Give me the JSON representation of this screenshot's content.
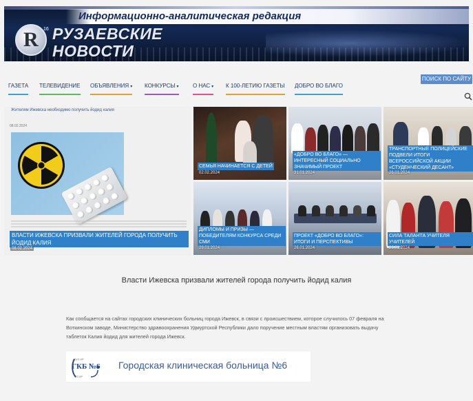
{
  "header": {
    "tagline": "Информационно-аналитическая редакция",
    "logo_letter": "R",
    "logo_age": "16",
    "logo_line1": "РУЗАЕВСКИЕ",
    "logo_line2": "НОВОСТИ",
    "search_button": "ПОИСК ПО САЙТУ"
  },
  "nav": {
    "items": [
      {
        "label": "ГАЗЕТА",
        "underline": "#3aa0d8"
      },
      {
        "label": "ТЕЛЕВИДЕНИЕ",
        "underline": "#5cb85c"
      },
      {
        "label": "ОБЪЯВЛЕНИЯ",
        "underline": "#e0a030",
        "caret": "▾"
      },
      {
        "label": "КОНКУРСЫ",
        "underline": "#9b59b6",
        "caret": "▾"
      },
      {
        "label": "О НАС",
        "underline": "#e74c8c",
        "caret": "▾"
      },
      {
        "label": "К 100-ЛЕТИЮ ГАЗЕТЫ",
        "underline": "#e0a030"
      },
      {
        "label": "ДОБРО ВО БЛАГО",
        "underline": "#3aa0d8"
      }
    ]
  },
  "featured": {
    "top_caption": "Жителям Ижевска необходимо получить йодид калия",
    "top_date": "08.02.2024",
    "title": "ВЛАСТИ ИЖЕВСКА ПРИЗВАЛИ ЖИТЕЛЕЙ ГОРОДА ПОЛУЧИТЬ ЙОДИД КАЛИЯ",
    "date": "08.02.2024"
  },
  "tiles": [
    {
      "title": "СЕМЬЯ НАЧИНАЕТСЯ С ДЕТЕЙ",
      "date": "02.02.2024"
    },
    {
      "title": "«ДОБРО ВО БЛАГО» — ИНТЕРЕСНЫЙ СОЦИАЛЬНО ЗНАЧИМЫЙ ПРОЕКТ",
      "date": "31.01.2024"
    },
    {
      "title": "ТРАНСПОРТНЫЕ ПОЛИЦЕЙСКИЕ ПОДВЕЛИ ИТОГИ ВСЕРОССИЙСКОЙ АКЦИИ «СТУДЕНЧЕСКИЙ ДЕСАНТ»",
      "date": "26.01.2024"
    },
    {
      "title": "ДИПЛОМЫ И ПРИЗЫ — ПОБЕДИТЕЛЯМ КОНКУРСА СРЕДИ СМИ",
      "date": "29.01.2024"
    },
    {
      "title": "ПРОЕКТ «ДОБРО ВО БЛАГО»: ИТОГИ И ПЕРСПЕКТИВЫ",
      "date": "26.01.2024"
    },
    {
      "title": "СИЛА ТАЛАНТА УЧИТЕЛЯ УЧИТЕЛЕЙ",
      "date": "26.01.2024"
    }
  ],
  "article": {
    "title": "Власти Ижевска призвали жителей города получить йодид калия",
    "body": "Как сообщается на сайтах городских клинических больниц города Ижевск, в связи с происшествием, которое случилось 07 февраля на Воткинском заводе, Министерство здравоохранения Удмуртской Республики дало поручение местным властям организовать выдачу таблеток Калия йодид для жителей города Ижевск."
  },
  "hospital": {
    "abbr_top": "БУЗ УР",
    "abbr": "ГКБ №6",
    "abbr_bottom": "МЗ УР",
    "name": "Городская клиническая больница №6"
  },
  "colors": {
    "accent": "#2f80c9",
    "nav_text": "#1f3a66",
    "search_button": "#5a8ccf",
    "banner": "#142a55"
  }
}
